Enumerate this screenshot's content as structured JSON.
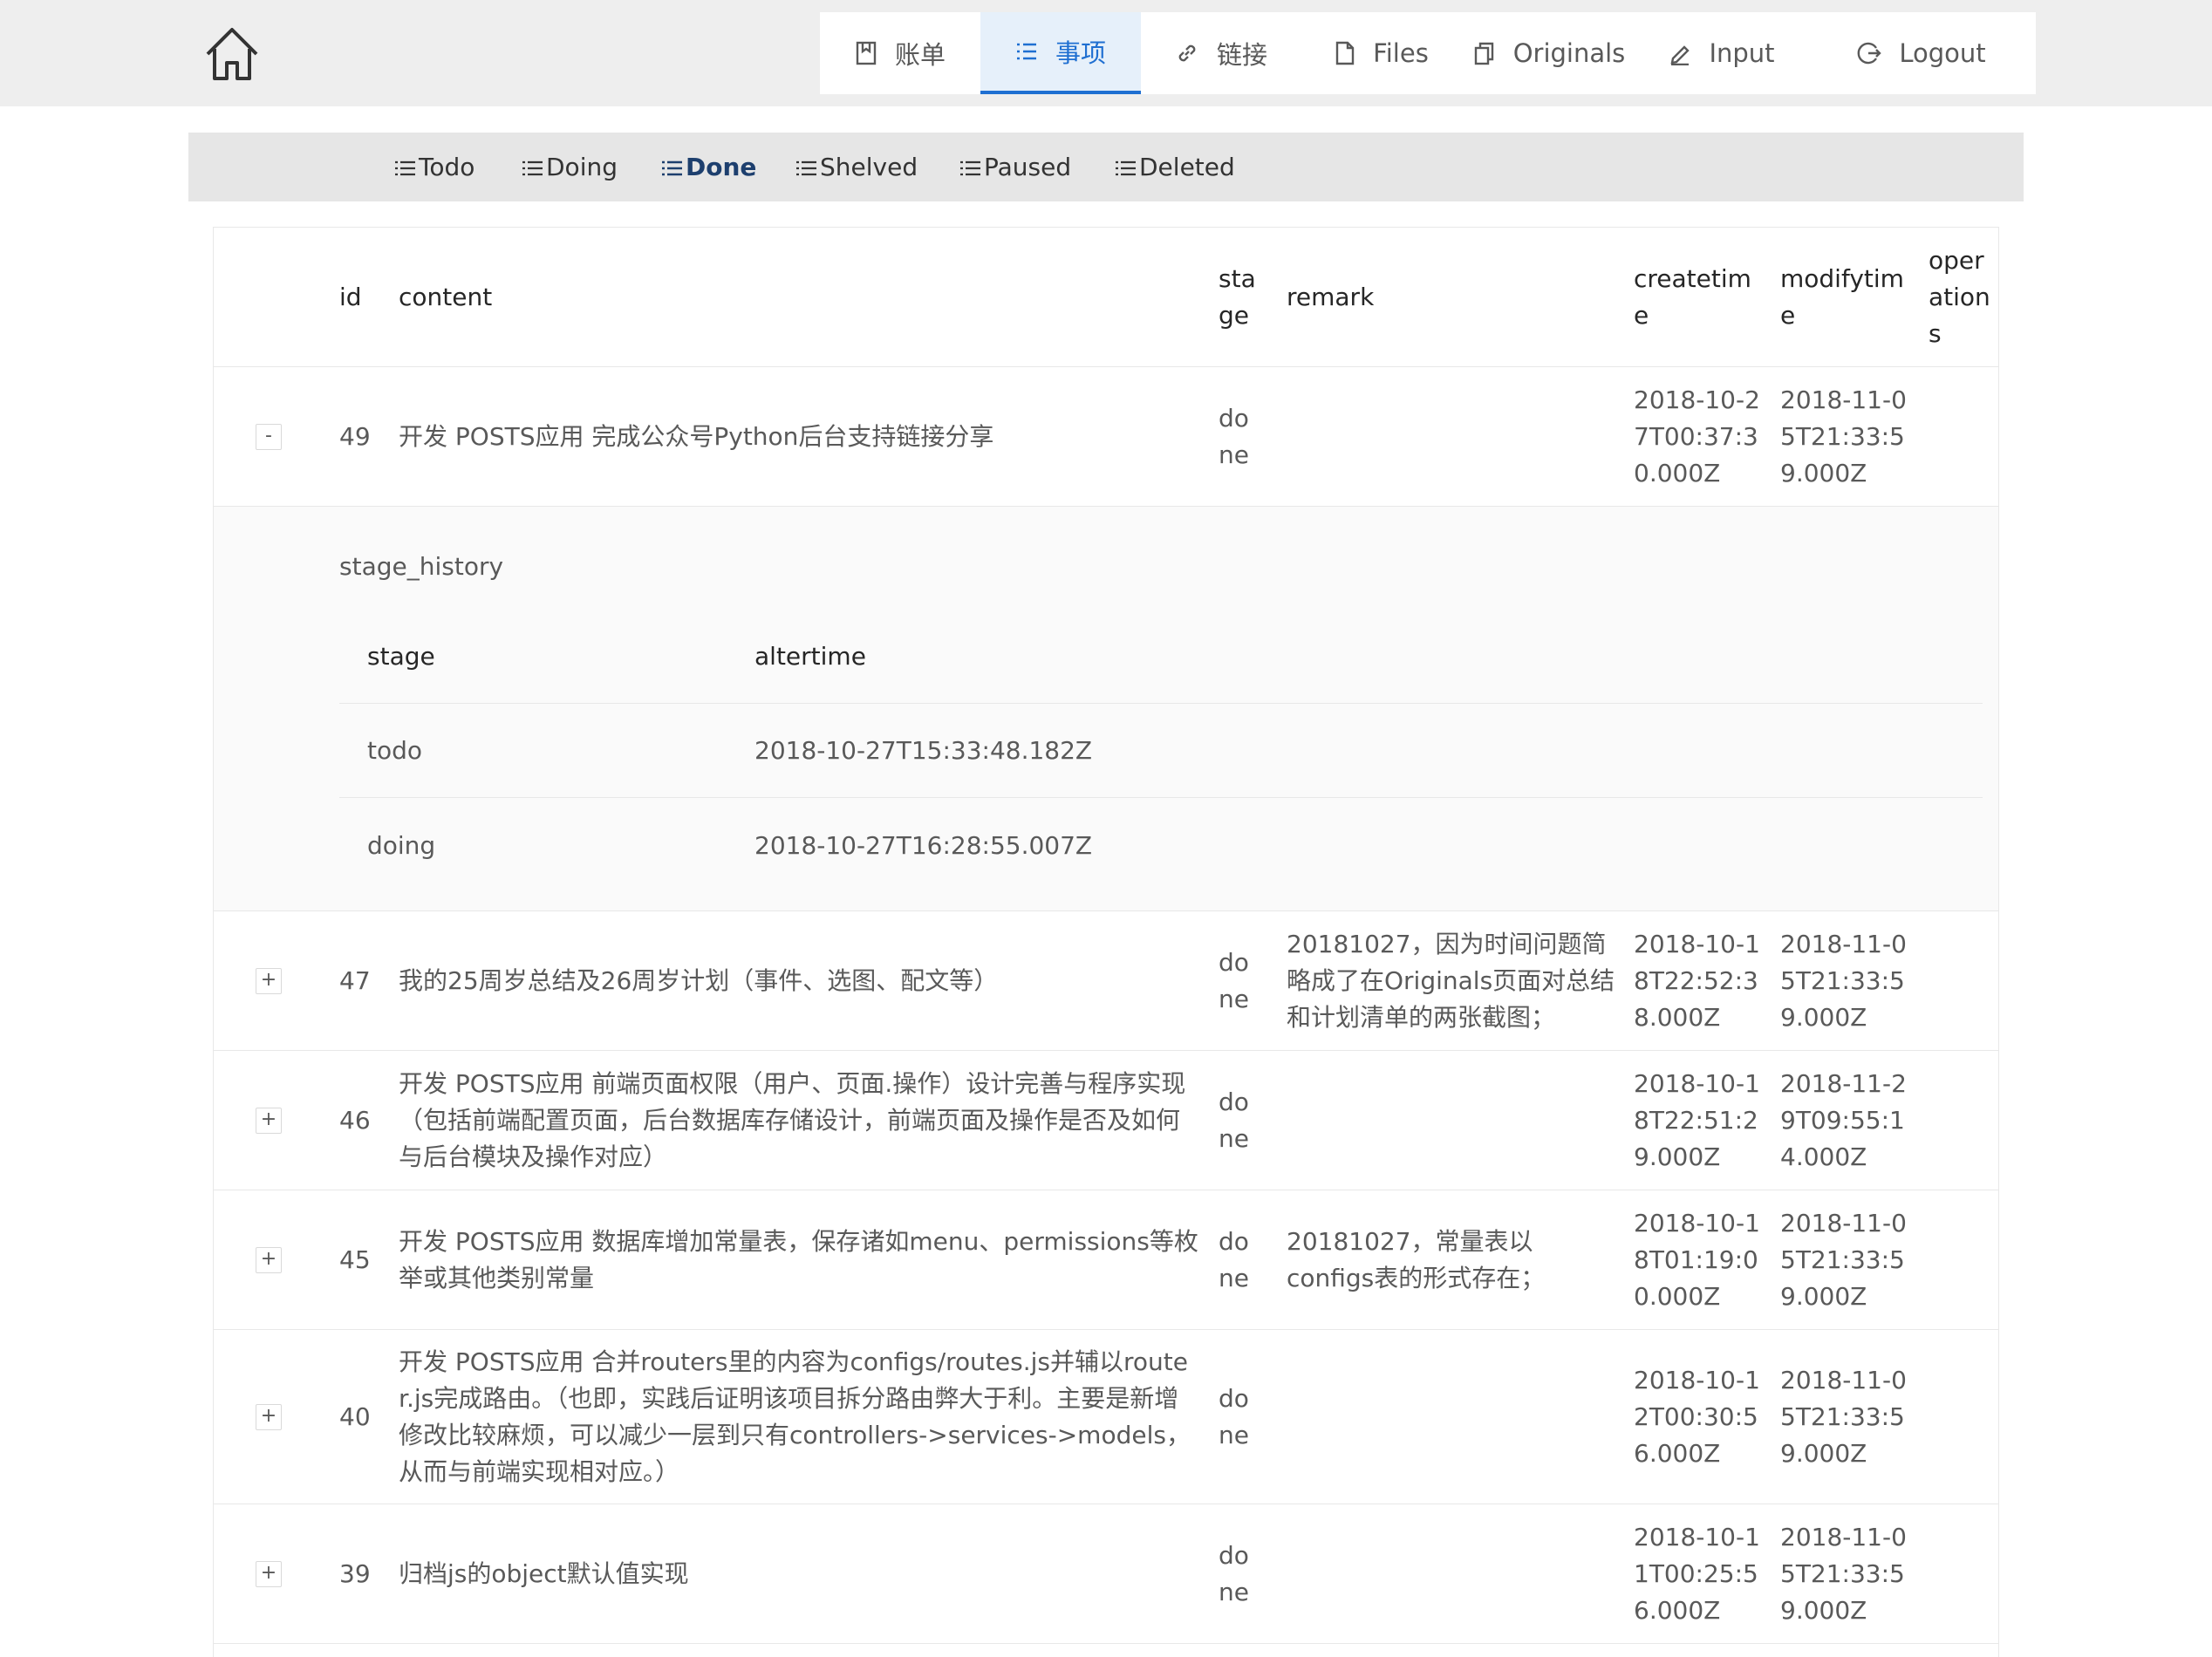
{
  "nav": {
    "items": [
      {
        "label": "账单",
        "icon": "book-icon",
        "active": false
      },
      {
        "label": "事项",
        "icon": "list-icon",
        "active": true
      },
      {
        "label": "链接",
        "icon": "link-icon",
        "active": false
      },
      {
        "label": "Files",
        "icon": "file-icon",
        "active": false
      },
      {
        "label": "Originals",
        "icon": "copy-icon",
        "active": false
      },
      {
        "label": "Input",
        "icon": "edit-icon",
        "active": false
      },
      {
        "label": "Logout",
        "icon": "logout-icon",
        "active": false
      }
    ]
  },
  "subnav": {
    "items": [
      {
        "label": "Todo",
        "active": false
      },
      {
        "label": "Doing",
        "active": false
      },
      {
        "label": "Done",
        "active": true
      },
      {
        "label": "Shelved",
        "active": false
      },
      {
        "label": "Paused",
        "active": false
      },
      {
        "label": "Deleted",
        "active": false
      }
    ]
  },
  "table": {
    "headers": {
      "id": "id",
      "content": "content",
      "stage": "stage",
      "remark": "remark",
      "createtime": "createtime",
      "modifytime": "modifytime",
      "operations": "operations"
    },
    "rows": [
      {
        "expander": "-",
        "id": "49",
        "content": "开发 POSTS应用 完成公众号Python后台支持链接分享",
        "stage": "done",
        "remark": "",
        "createtime": "2018-10-27T00:37:30.000Z",
        "modifytime": "2018-11-05T21:33:59.000Z"
      },
      {
        "expander": "+",
        "id": "47",
        "content": "我的25周岁总结及26周岁计划（事件、选图、配文等）",
        "stage": "done",
        "remark": "20181027，因为时间问题简略成了在Originals页面对总结和计划清单的两张截图；",
        "createtime": "2018-10-18T22:52:38.000Z",
        "modifytime": "2018-11-05T21:33:59.000Z"
      },
      {
        "expander": "+",
        "id": "46",
        "content": "开发 POSTS应用 前端页面权限（用户、页面.操作）设计完善与程序实现（包括前端配置页面，后台数据库存储设计，前端页面及操作是否及如何与后台模块及操作对应）",
        "stage": "done",
        "remark": "",
        "createtime": "2018-10-18T22:51:29.000Z",
        "modifytime": "2018-11-29T09:55:14.000Z"
      },
      {
        "expander": "+",
        "id": "45",
        "content": "开发 POSTS应用 数据库增加常量表，保存诸如menu、permissions等枚举或其他类别常量",
        "stage": "done",
        "remark": "20181027，常量表以configs表的形式存在；",
        "createtime": "2018-10-18T01:19:00.000Z",
        "modifytime": "2018-11-05T21:33:59.000Z"
      },
      {
        "expander": "+",
        "id": "40",
        "content": "开发 POSTS应用 合并routers里的内容为configs/routes.js并辅以router.js完成路由。（也即，实践后证明该项目拆分路由弊大于利。主要是新增修改比较麻烦，可以减少一层到只有controllers->services->models，从而与前端实现相对应。）",
        "stage": "done",
        "remark": "",
        "createtime": "2018-10-12T00:30:56.000Z",
        "modifytime": "2018-11-05T21:33:59.000Z"
      },
      {
        "expander": "+",
        "id": "39",
        "content": "归档js的object默认值实现",
        "stage": "done",
        "remark": "",
        "createtime": "2018-10-11T00:25:56.000Z",
        "modifytime": "2018-11-05T21:33:59.000Z"
      }
    ],
    "expanded": {
      "title": "stage_history",
      "headers": {
        "stage": "stage",
        "altertime": "altertime"
      },
      "rows": [
        {
          "stage": "todo",
          "altertime": "2018-10-27T15:33:48.182Z"
        },
        {
          "stage": "doing",
          "altertime": "2018-10-27T16:28:55.007Z"
        }
      ]
    }
  }
}
